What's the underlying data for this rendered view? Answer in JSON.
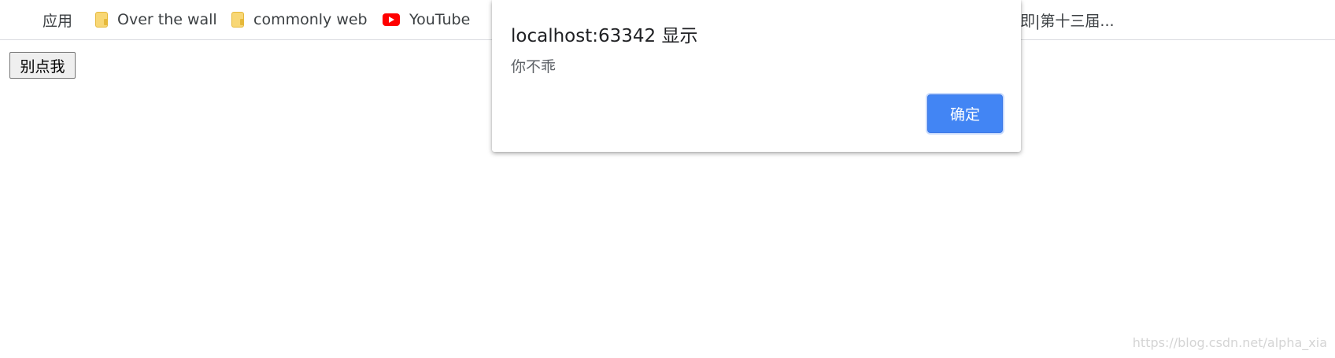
{
  "bookmarks": [
    {
      "label": "应用",
      "icon": "apps-grid-icon"
    },
    {
      "label": "Over the wall",
      "icon": "folder-icon"
    },
    {
      "label": "commonly web",
      "icon": "folder-icon"
    },
    {
      "label": "YouTube",
      "icon": "youtube-icon"
    }
  ],
  "bookmark_truncated": "即|第十三届...",
  "page": {
    "button_label": "别点我"
  },
  "alert": {
    "title": "localhost:63342 显示",
    "message": "你不乖",
    "ok_label": "确定"
  },
  "watermark": "https://blog.csdn.net/alpha_xia",
  "colors": {
    "accent": "#4285f4",
    "youtube": "#ff0000",
    "folder": "#f8d775"
  }
}
